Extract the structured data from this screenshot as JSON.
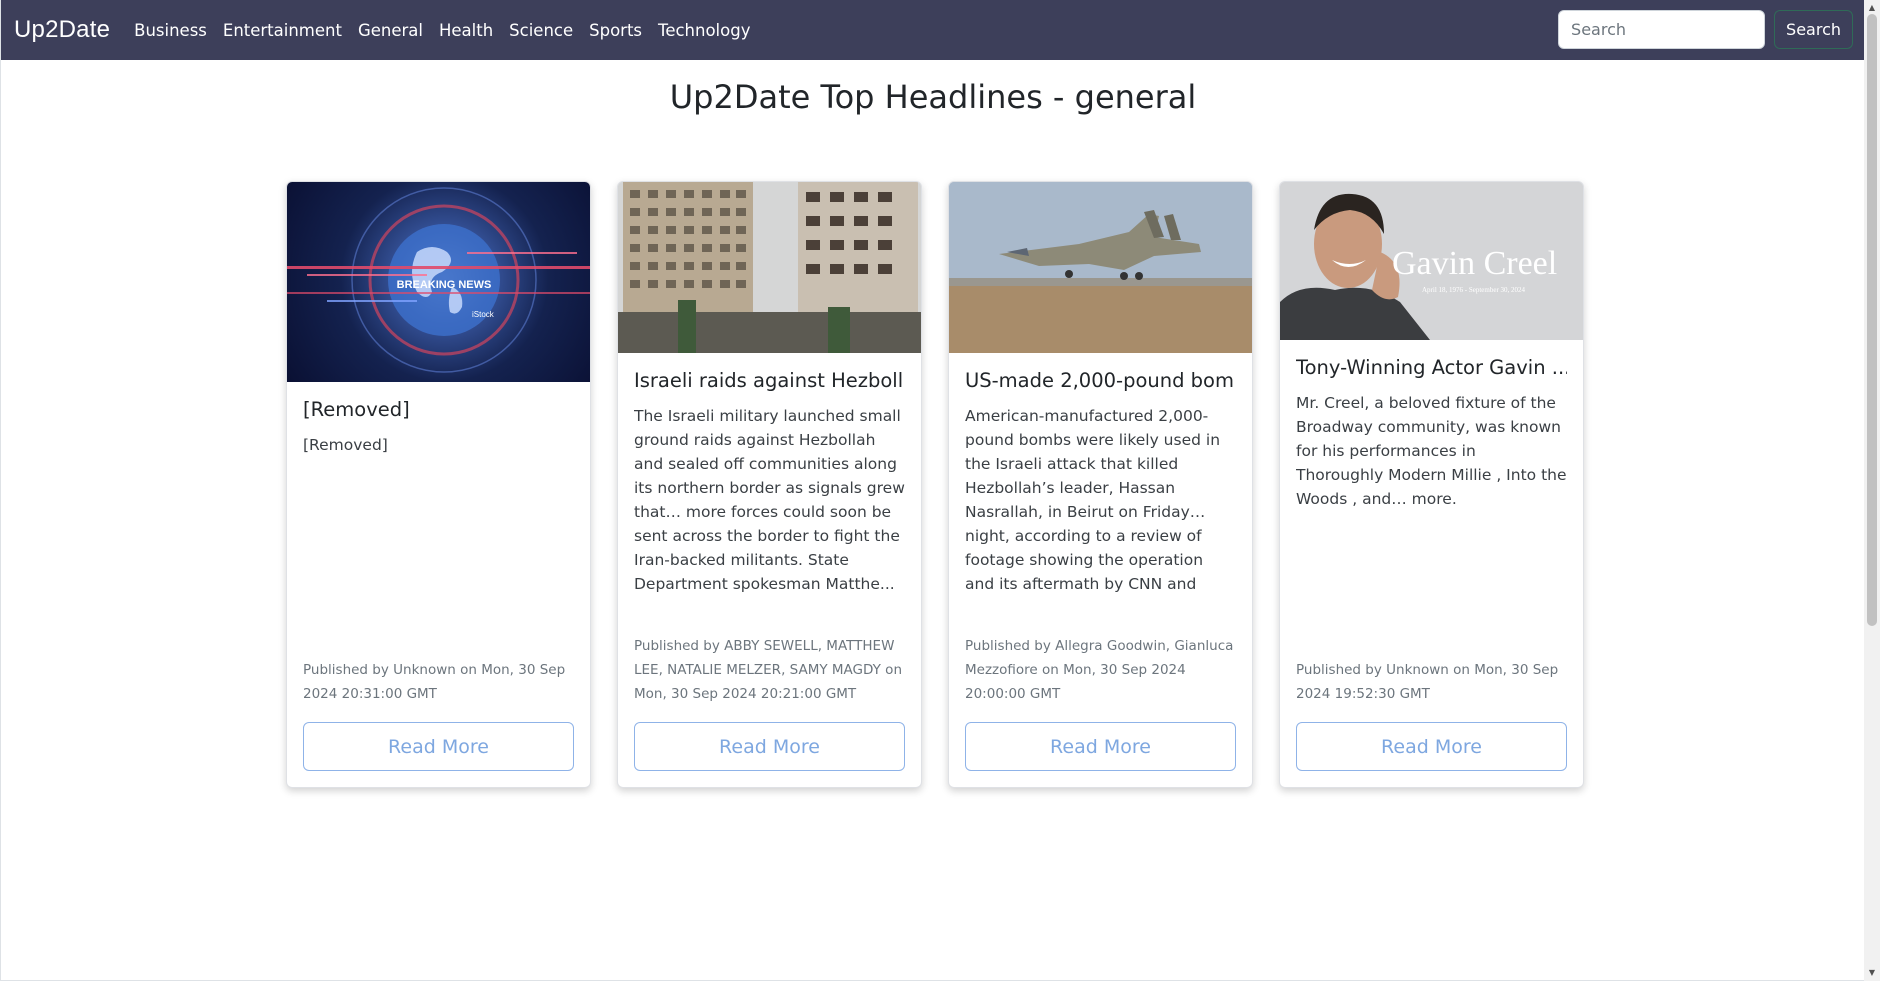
{
  "navbar": {
    "brand": "Up2Date",
    "links": [
      "Business",
      "Entertainment",
      "General",
      "Health",
      "Science",
      "Sports",
      "Technology"
    ],
    "search_placeholder": "Search",
    "search_button": "Search"
  },
  "page_title": "Up2Date Top Headlines - general",
  "cards": [
    {
      "image_alt": "breaking-news-image",
      "image_text": "BREAKING NEWS",
      "title": "[Removed]",
      "text": "[Removed]",
      "meta": "Published by Unknown on Mon, 30 Sep 2024 20:31:00 GMT",
      "button": "Read More"
    },
    {
      "image_alt": "damaged-apartment-building-image",
      "title": "Israeli raids against Hezboll...",
      "text": "The Israeli military launched small ground raids against Hezbollah and sealed off communities along its northern border as signals grew that… more forces could soon be sent across the border to fight the Iran-backed militants. State Department spokesman Matthe...",
      "meta": "Published by ABBY SEWELL, MATTHEW LEE, NATALIE MELZER, SAMY MAGDY on Mon, 30 Sep 2024 20:21:00 GMT",
      "button": "Read More"
    },
    {
      "image_alt": "fighter-jet-image",
      "title": "US-made 2,000-pound bom...",
      "text": "American-manufactured 2,000-pound bombs were likely used in the Israeli attack that killed Hezbollah’s leader, Hassan Nasrallah, in Beirut on Friday… night, according to a review of footage showing the operation and its aftermath by CNN and munitions experts.",
      "meta": "Published by Allegra Goodwin, Gianluca Mezzofiore on Mon, 30 Sep 2024 20:00:00 GMT",
      "button": "Read More"
    },
    {
      "image_alt": "gavin-creel-portrait-image",
      "image_text": "Gavin Creel",
      "image_subtext": "April 18, 1976 - September 30, 2024",
      "title": "Tony-Winning Actor Gavin ...",
      "text": "Mr. Creel, a beloved fixture of the Broadway community, was known for his performances in Thoroughly Modern Millie , Into the Woods , and… more.",
      "meta": "Published by Unknown on Mon, 30 Sep 2024 19:52:30 GMT",
      "button": "Read More"
    }
  ]
}
